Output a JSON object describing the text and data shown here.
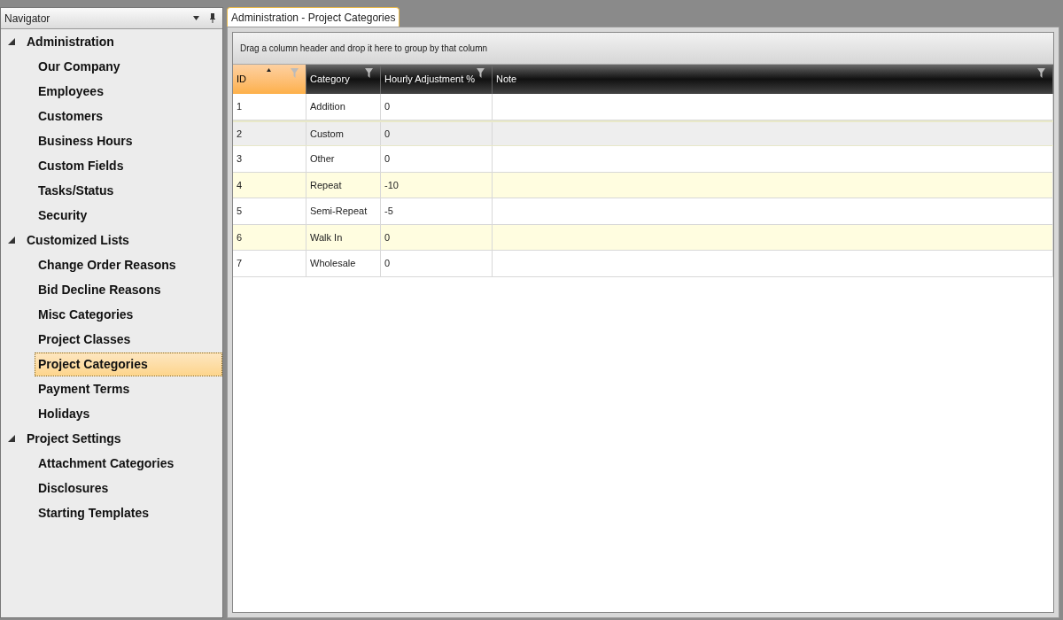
{
  "navigator": {
    "title": "Navigator",
    "groups": [
      {
        "label": "Administration",
        "expanded": true,
        "children": [
          {
            "label": "Our Company",
            "selected": false
          },
          {
            "label": "Employees",
            "selected": false
          },
          {
            "label": "Customers",
            "selected": false
          },
          {
            "label": "Business Hours",
            "selected": false
          },
          {
            "label": "Custom Fields",
            "selected": false
          },
          {
            "label": "Tasks/Status",
            "selected": false
          },
          {
            "label": "Security",
            "selected": false
          }
        ]
      },
      {
        "label": "Customized Lists",
        "expanded": true,
        "children": [
          {
            "label": "Change Order Reasons",
            "selected": false
          },
          {
            "label": "Bid Decline Reasons",
            "selected": false
          },
          {
            "label": "Misc Categories",
            "selected": false
          },
          {
            "label": "Project Classes",
            "selected": false
          },
          {
            "label": "Project Categories",
            "selected": true
          },
          {
            "label": "Payment Terms",
            "selected": false
          },
          {
            "label": "Holidays",
            "selected": false
          }
        ]
      },
      {
        "label": "Project Settings",
        "expanded": true,
        "children": [
          {
            "label": "Attachment Categories",
            "selected": false
          },
          {
            "label": "Disclosures",
            "selected": false
          },
          {
            "label": "Starting Templates",
            "selected": false
          }
        ]
      }
    ]
  },
  "tabs": [
    {
      "label": "Administration - Project Categories",
      "selected": true
    }
  ],
  "grid": {
    "group_panel": "Drag a column header and drop it here to group by that column",
    "columns": [
      {
        "label": "ID",
        "sorted": true
      },
      {
        "label": "Category",
        "sorted": false
      },
      {
        "label": "Hourly Adjustment %",
        "sorted": false
      },
      {
        "label": "Note",
        "sorted": false
      }
    ],
    "rows": [
      {
        "cells": [
          "1",
          "Addition",
          "0",
          ""
        ],
        "selected": false
      },
      {
        "cells": [
          "2",
          "Custom",
          "0",
          ""
        ],
        "selected": true
      },
      {
        "cells": [
          "3",
          "Other",
          "0",
          ""
        ],
        "selected": false
      },
      {
        "cells": [
          "4",
          "Repeat",
          "-10",
          ""
        ],
        "selected": false
      },
      {
        "cells": [
          "5",
          "Semi-Repeat",
          "-5",
          ""
        ],
        "selected": false
      },
      {
        "cells": [
          "6",
          "Walk In",
          "0",
          ""
        ],
        "selected": false
      },
      {
        "cells": [
          "7",
          "Wholesale",
          "0",
          ""
        ],
        "selected": false
      }
    ]
  }
}
